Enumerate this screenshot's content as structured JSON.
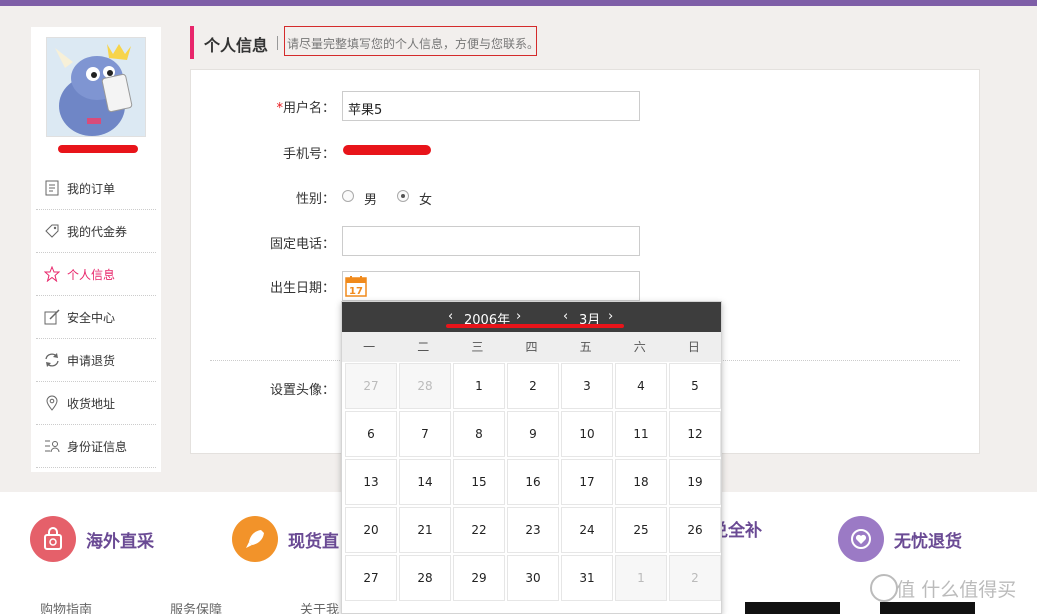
{
  "sidebar": {
    "menu": [
      {
        "label": "我的订单",
        "icon": "order-icon"
      },
      {
        "label": "我的代金券",
        "icon": "coupon-tag-icon"
      },
      {
        "label": "个人信息",
        "icon": "star-icon",
        "active": true
      },
      {
        "label": "安全中心",
        "icon": "edit-icon"
      },
      {
        "label": "申请退货",
        "icon": "refresh-icon"
      },
      {
        "label": "收货地址",
        "icon": "location-pin-icon"
      },
      {
        "label": "身份证信息",
        "icon": "id-card-icon"
      }
    ]
  },
  "header": {
    "title": "个人信息",
    "hint": "请尽量完整填写您的个人信息，方便与您联系。"
  },
  "form": {
    "username": {
      "required_mark": "*",
      "label": "用户名：",
      "value": "苹果5"
    },
    "phone": {
      "label": "手机号："
    },
    "gender": {
      "label": "性别：",
      "options": [
        "男",
        "女"
      ],
      "selected": "女"
    },
    "landline": {
      "label": "固定电话：",
      "value": ""
    },
    "birthday": {
      "label": "出生日期：",
      "icon": "calendar-17-icon"
    },
    "avatar": {
      "label": "设置头像："
    }
  },
  "calendar": {
    "year_label": "2006年",
    "month_label": "3月",
    "prev_year": "‹",
    "next_year": "›",
    "prev_month": "‹",
    "next_month": "›",
    "weekdays": [
      "一",
      "二",
      "三",
      "四",
      "五",
      "六",
      "日"
    ],
    "days": [
      "27",
      "28",
      "1",
      "2",
      "3",
      "4",
      "5",
      "6",
      "7",
      "8",
      "9",
      "10",
      "11",
      "12",
      "13",
      "14",
      "15",
      "16",
      "17",
      "18",
      "19",
      "20",
      "21",
      "22",
      "23",
      "24",
      "25",
      "26",
      "27",
      "28",
      "29",
      "30",
      "31",
      "1",
      "2"
    ],
    "dim_indices": [
      0,
      1,
      33,
      34
    ]
  },
  "footer": {
    "features": [
      {
        "label": "海外直采",
        "color": "#e5606a",
        "icon": "shopping-bag-icon"
      },
      {
        "label": "现货直",
        "color": "#f2932a",
        "icon": "rocket-icon"
      },
      {
        "label": "兑全补",
        "color": "#7e5ea7",
        "icon": "shield-icon"
      },
      {
        "label": "无忧退货",
        "color": "#9b7ac5",
        "icon": "heart-return-icon"
      }
    ],
    "links": [
      "购物指南",
      "服务保障",
      "关于我"
    ]
  },
  "watermark": "值 什么值得买"
}
